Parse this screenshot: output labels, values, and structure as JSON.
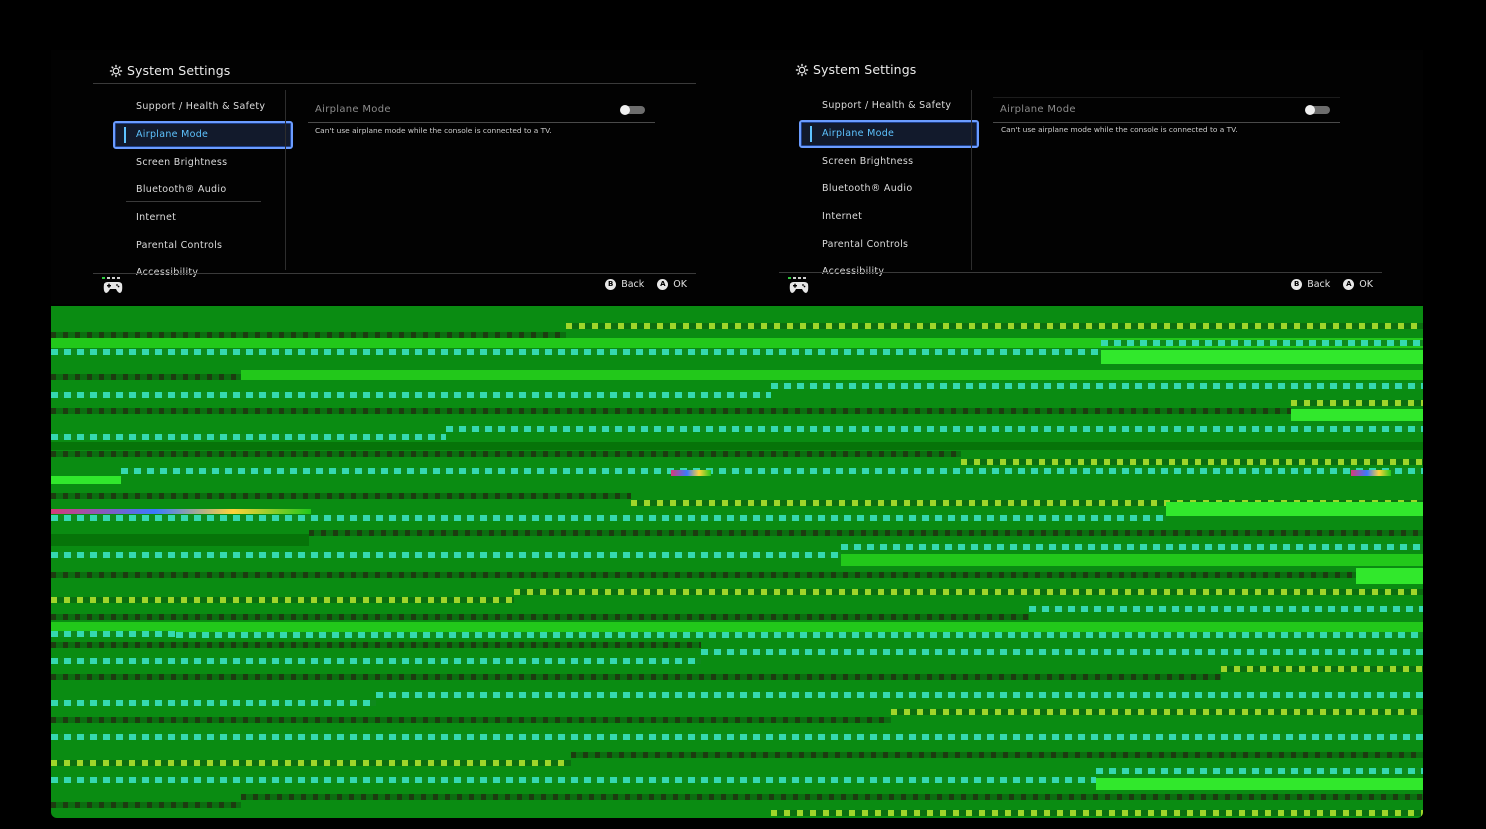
{
  "screens": [
    {
      "title": "System Settings",
      "nav": [
        {
          "label": "Support / Health & Safety",
          "selected": false
        },
        {
          "label": "Airplane Mode",
          "selected": true
        },
        {
          "label": "Screen Brightness",
          "selected": false
        },
        {
          "label": "Bluetooth® Audio",
          "selected": false
        },
        {
          "label": "Internet",
          "selected": false
        },
        {
          "label": "Parental Controls",
          "selected": false
        },
        {
          "label": "Accessibility",
          "selected": false
        }
      ],
      "setting": {
        "label": "Airplane Mode",
        "toggle_on": false,
        "note": "Can't use airplane mode while the console is connected to a TV."
      },
      "footer": {
        "back_label": "Back",
        "back_glyph": "B",
        "ok_label": "OK",
        "ok_glyph": "A"
      }
    },
    {
      "title": "System Settings",
      "nav": [
        {
          "label": "Support / Health & Safety",
          "selected": false
        },
        {
          "label": "Airplane Mode",
          "selected": true
        },
        {
          "label": "Screen Brightness",
          "selected": false
        },
        {
          "label": "Bluetooth® Audio",
          "selected": false
        },
        {
          "label": "Internet",
          "selected": false
        },
        {
          "label": "Parental Controls",
          "selected": false
        },
        {
          "label": "Accessibility",
          "selected": false
        }
      ],
      "setting": {
        "label": "Airplane Mode",
        "toggle_on": false,
        "note": "Can't use airplane mode while the console is connected to a TV."
      },
      "footer": {
        "back_label": "Back",
        "back_glyph": "B",
        "ok_label": "OK",
        "ok_glyph": "A"
      }
    }
  ],
  "colors": {
    "background": "#000000",
    "selection_border": "#6b9cff",
    "selection_text": "#5ec3ff",
    "glitch_green": "#0a8c12"
  },
  "icons": [
    "gear-icon",
    "controller-icon",
    "b-button-icon",
    "a-button-icon"
  ]
}
